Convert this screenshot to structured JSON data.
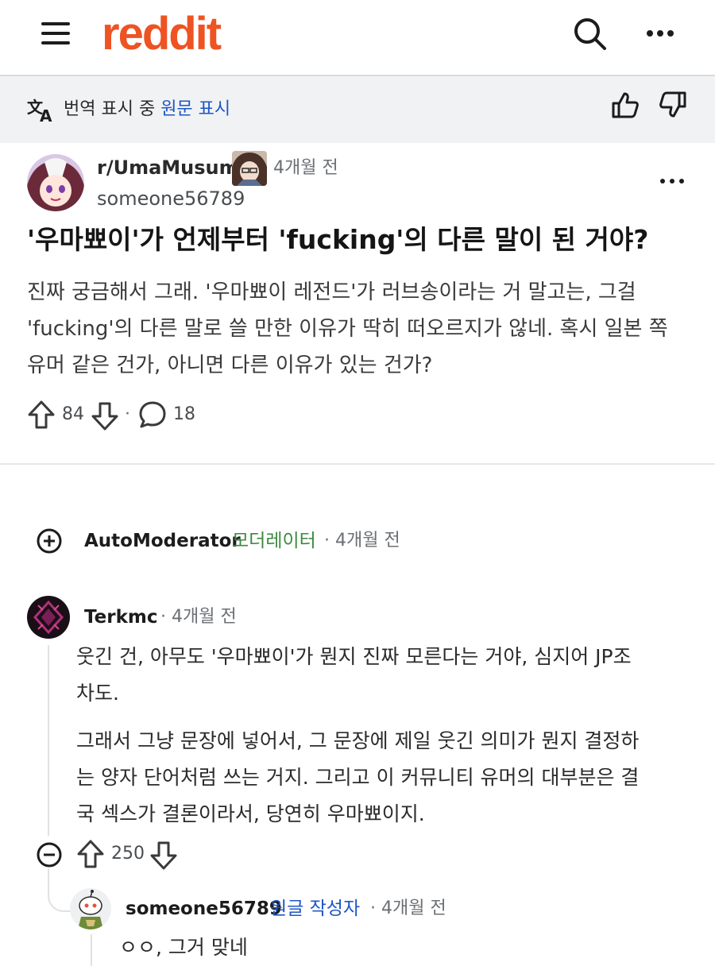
{
  "header": {
    "logo": "reddit",
    "menu_icon": "hamburger-icon",
    "search_icon": "search-icon",
    "more_icon": "more-horizontal-icon"
  },
  "translation_bar": {
    "status": "번역 표시 중",
    "original_link": "원문 표시",
    "icons": [
      "translate-icon",
      "thumbs-up-icon",
      "thumbs-down-icon"
    ]
  },
  "post": {
    "subreddit": "r/UmaMusume",
    "time": "4개월 전",
    "author": "someone56789",
    "title": "'우마뾰이'가 언제부터 'fucking'의 다른 말이 된 거야?",
    "body_lines": [
      "진짜 궁금해서 그래. '우마뾰이 레전드'가 러브송이라는 거 말고는, 그걸",
      "'fucking'의 다른 말로 쓸 만한 이유가 딱히 떠오르지가 않네. 혹시 일본 쪽",
      "유머 같은 건가, 아니면 다른 이유가 있는 건가?"
    ],
    "upvotes": "84",
    "comments": "18",
    "dot": "·"
  },
  "comments": [
    {
      "author": "AutoModerator",
      "badge": "모더레이터",
      "time": "· 4개월 전"
    },
    {
      "author": "Terkmc",
      "time": "· 4개월 전",
      "paragraphs": [
        [
          "웃긴 건, 아무도 '우마뾰이'가 뭔지 진짜 모른다는 거야, 심지어 JP조",
          "차도."
        ],
        [
          "그래서 그냥 문장에 넣어서, 그 문장에 제일 웃긴 의미가 뭔지 결정하",
          "는 양자 단어처럼 쓰는 거지. 그리고 이 커뮤니티 유머의 대부분은 결",
          "국 섹스가 결론이라서, 당연히 우마뾰이지."
        ]
      ],
      "upvotes": "250"
    },
    {
      "author": "someone56789",
      "badge": "원글 작성자",
      "time": "· 4개월 전",
      "body": "ㅇㅇ, 그거 맞네"
    }
  ],
  "colors": {
    "brand": "#ee5323",
    "link": "#1d55c4",
    "moderator": "#3b8a3e"
  }
}
